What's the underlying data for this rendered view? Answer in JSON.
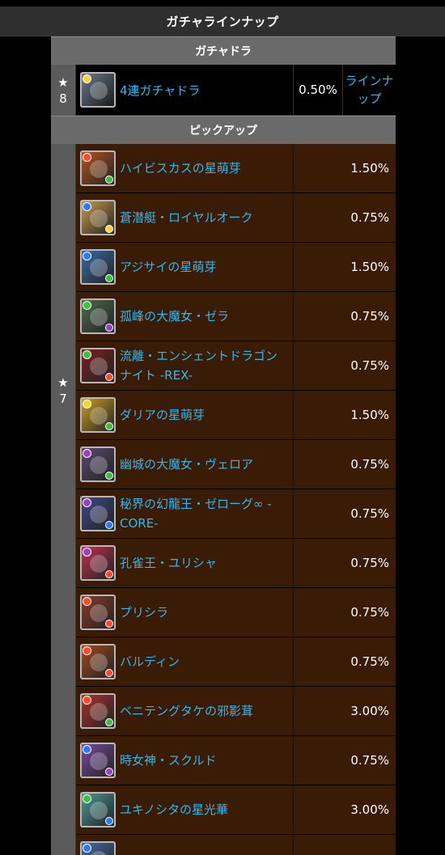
{
  "header": {
    "title": "ガチャラインナップ"
  },
  "gacha_dragon": {
    "section_title": "ガチャドラ",
    "rarity_star": "★",
    "rarity_num": "8",
    "item": {
      "name": "4連ガチャドラ",
      "rate": "0.50%",
      "link": "ラインナップ",
      "icon_color": "#6c7a8c"
    }
  },
  "pickup": {
    "section_title": "ピックアップ",
    "rarity_star": "★",
    "rarity_num": "7",
    "items": [
      {
        "name": "ハイビスカスの星萌芽",
        "rate": "1.50%",
        "icon_color": "#b5531f",
        "attr": "#ff4a2a",
        "attr2": "#3fbf3f"
      },
      {
        "name": "蒼潜艇・ロイヤルオーク",
        "rate": "0.75%",
        "icon_color": "#c89a4a",
        "attr": "#2a7cff",
        "attr2": "#ffd230"
      },
      {
        "name": "アジサイの星萌芽",
        "rate": "1.50%",
        "icon_color": "#3b6aa6",
        "attr": "#2a7cff",
        "attr2": "#3fbf3f"
      },
      {
        "name": "孤峰の大魔女・ゼラ",
        "rate": "0.75%",
        "icon_color": "#4e6a4e",
        "attr": "#3fbf3f",
        "attr2": "#a040c0"
      },
      {
        "name": "流離・エンシェントドラゴンナイト -REX-",
        "rate": "0.75%",
        "icon_color": "#7a2020",
        "attr": "#3fbf3f",
        "attr2": "#ff4a2a"
      },
      {
        "name": "ダリアの星萌芽",
        "rate": "1.50%",
        "icon_color": "#c9a020",
        "attr": "#ffd230",
        "attr2": "#3fbf3f"
      },
      {
        "name": "幽城の大魔女・ヴェロア",
        "rate": "0.75%",
        "icon_color": "#5a4a70",
        "attr": "#a040c0",
        "attr2": "#3fbf3f"
      },
      {
        "name": "秘界の幻龍王・ゼローグ∞ -CORE-",
        "rate": "0.75%",
        "icon_color": "#3e4a8a",
        "attr": "#a040c0",
        "attr2": "#2a7cff"
      },
      {
        "name": "孔雀王・ユリシャ",
        "rate": "0.75%",
        "icon_color": "#c03050",
        "attr": "#a040c0",
        "attr2": "#ff4a2a"
      },
      {
        "name": "プリシラ",
        "rate": "0.75%",
        "icon_color": "#8a3a2a",
        "attr": "#ff4a2a",
        "attr2": "#ff4a2a"
      }
    ]
  },
  "group2": {
    "items": [
      {
        "name": "バルディン",
        "rate": "0.75%",
        "icon_color": "#a04a20",
        "attr": "#ff4a2a",
        "attr2": "#ff4a2a"
      },
      {
        "name": "ベニテングタケの邪影茸",
        "rate": "3.00%",
        "icon_color": "#b03030",
        "attr": "#ff4a2a",
        "attr2": "#3fbf3f"
      },
      {
        "name": "時女神・スクルド",
        "rate": "0.75%",
        "icon_color": "#7a4aa0",
        "attr": "#2a7cff",
        "attr2": "#a040c0"
      },
      {
        "name": "ユキノシタの星光華",
        "rate": "3.00%",
        "icon_color": "#4a9a9a",
        "attr": "#3fbf3f",
        "attr2": "#2a7cff"
      },
      {
        "name": "",
        "rate": "",
        "icon_color": "#4a6aa0",
        "attr": "#2a7cff",
        "attr2": "#2a7cff"
      }
    ]
  }
}
